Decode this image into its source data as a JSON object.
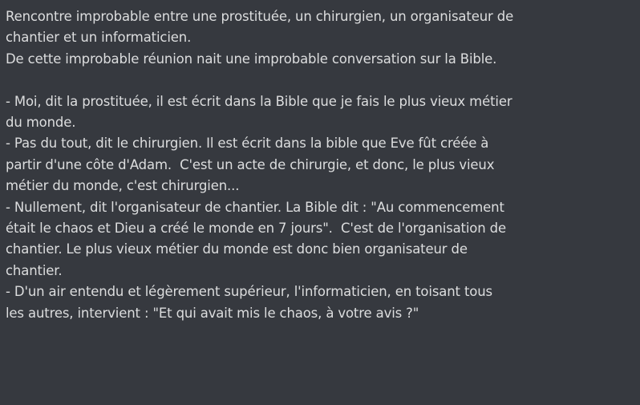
{
  "message": {
    "lines": [
      "Rencontre improbable entre une prostituée, un chirurgien, un organisateur de",
      "chantier et un informaticien.",
      "De cette improbable réunion nait une improbable conversation sur la Bible.",
      "",
      "- Moi, dit la prostituée, il est écrit dans la Bible que je fais le plus vieux métier",
      "du monde.",
      "- Pas du tout, dit le chirurgien. Il est écrit dans la bible que Eve fût créée à",
      "partir d'une côte d'Adam.  C'est un acte de chirurgie, et donc, le plus vieux",
      "métier du monde, c'est chirurgien...",
      "- Nullement, dit l'organisateur de chantier. La Bible dit : \"Au commencement",
      "était le chaos et Dieu a créé le monde en 7 jours\".  C'est de l'organisation de",
      "chantier. Le plus vieux métier du monde est donc bien organisateur de",
      "chantier.",
      "- D'un air entendu et légèrement supérieur, l'informaticien, en toisant tous",
      "les autres, intervient : \"Et qui avait mis le chaos, à votre avis ?\""
    ]
  },
  "colors": {
    "background": "#36393f",
    "text": "#dcddde"
  }
}
